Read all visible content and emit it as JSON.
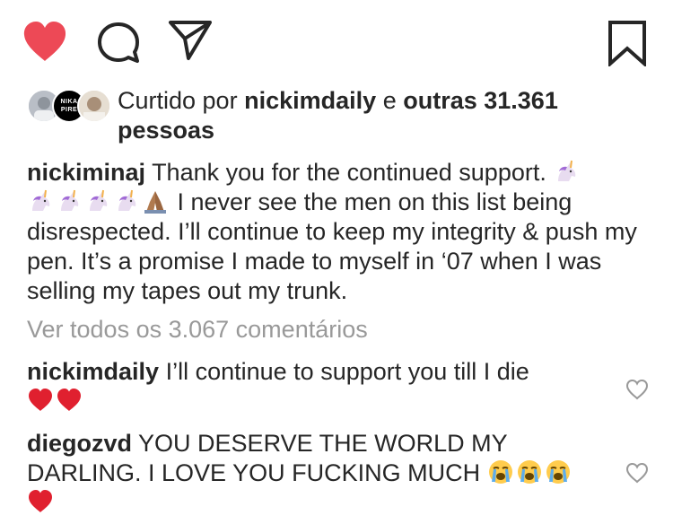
{
  "actions": {
    "like_icon": "heart-filled-icon",
    "comment_icon": "comment-bubble-icon",
    "share_icon": "paper-plane-icon",
    "save_icon": "bookmark-icon",
    "like_color": "#ed4956"
  },
  "likes": {
    "prefix": "Curtido por",
    "first_user": "nickimdaily",
    "joiner": "e",
    "others": "outras 31.361 pessoas",
    "avatar_2_label": "NIKA PIRE"
  },
  "caption": {
    "username": "nickiminaj",
    "text_1": "Thank you for the continued support.",
    "text_2": "I never see the men on this list being disrespected. I’ll continue to keep my integrity & push my pen. It’s a promise I made to myself in ‘07 when I was selling my tapes out my trunk."
  },
  "view_all": "Ver todos os 3.067 comentários",
  "comments": [
    {
      "username": "nickimdaily",
      "text": "I’ll continue to support you till I die"
    },
    {
      "username": "diegozvd",
      "text": "YOU DESERVE THE WORLD MY DARLING. I LOVE YOU FUCKING MUCH"
    }
  ]
}
